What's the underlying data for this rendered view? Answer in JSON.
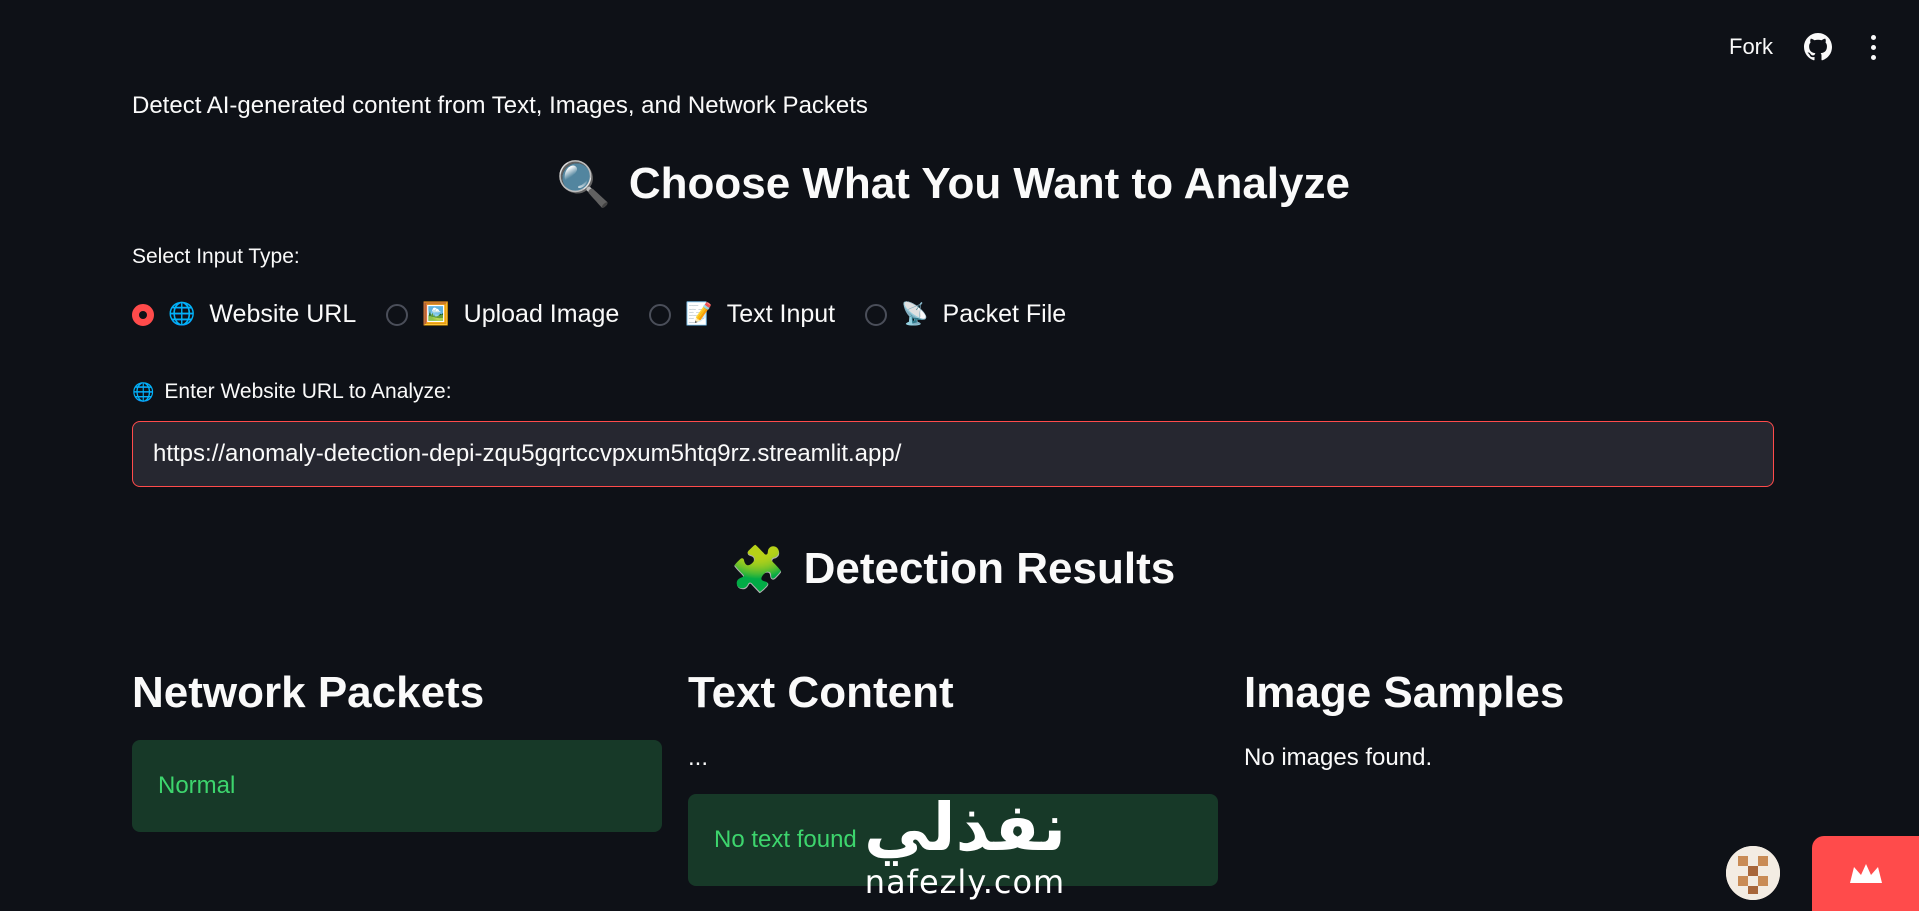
{
  "header": {
    "fork_label": "Fork",
    "icons": [
      "github-icon",
      "more-vertical-icon"
    ]
  },
  "subtitle": "Detect AI-generated content from Text, Images, and Network Packets",
  "choose_section": {
    "emoji": "🔍",
    "title": "Choose What You Want to Analyze"
  },
  "input_type": {
    "label": "Select Input Type:",
    "options": [
      {
        "emoji": "🌐",
        "label": "Website URL",
        "selected": true
      },
      {
        "emoji": "🖼️",
        "label": "Upload Image",
        "selected": false
      },
      {
        "emoji": "📝",
        "label": "Text Input",
        "selected": false
      },
      {
        "emoji": "📡",
        "label": "Packet File",
        "selected": false
      }
    ]
  },
  "url_field": {
    "emoji": "🌐",
    "label": "Enter Website URL to Analyze:",
    "value": "https://anomaly-detection-depi-zqu5gqrtccvpxum5htq9rz.streamlit.app/"
  },
  "results_section": {
    "emoji": "🧩",
    "title": "Detection Results"
  },
  "columns": {
    "network": {
      "title": "Network Packets",
      "status": "Normal"
    },
    "text": {
      "title": "Text Content",
      "preview": "...",
      "status": "No text found"
    },
    "images": {
      "title": "Image Samples",
      "message": "No images found."
    }
  },
  "watermark": {
    "arabic": "نفذلي",
    "latin": "nafezly.com"
  },
  "colors": {
    "background": "#0e1117",
    "accent": "#ff4b4b",
    "success_bg": "#173928",
    "success_text": "#3dd56d",
    "input_bg": "#262730"
  }
}
